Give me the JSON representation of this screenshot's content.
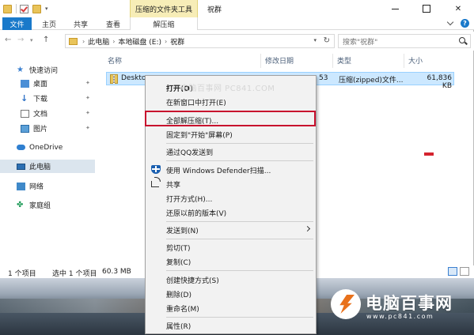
{
  "window": {
    "title": "祝群",
    "context_group": "压缩的文件夹工具"
  },
  "ribbon": {
    "tabs": [
      "文件",
      "主页",
      "共享",
      "查看",
      "解压缩"
    ]
  },
  "address": {
    "crumbs": [
      "此电脑",
      "本地磁盘 (E:)",
      "祝群"
    ],
    "search_placeholder": "搜索\"祝群\""
  },
  "nav": {
    "items": [
      {
        "label": "快速访问",
        "icon": "star-icon"
      },
      {
        "label": "桌面",
        "icon": "desktop-icon",
        "pinned": true
      },
      {
        "label": "下载",
        "icon": "download-icon",
        "pinned": true
      },
      {
        "label": "文档",
        "icon": "documents-icon",
        "pinned": true
      },
      {
        "label": "图片",
        "icon": "pictures-icon",
        "pinned": true
      },
      {
        "label": "OneDrive",
        "icon": "onedrive-icon"
      },
      {
        "label": "此电脑",
        "icon": "this-pc-icon",
        "selected": true
      },
      {
        "label": "网络",
        "icon": "network-icon"
      },
      {
        "label": "家庭组",
        "icon": "homegroup-icon"
      }
    ]
  },
  "columns": {
    "name": "名称",
    "date": "修改日期",
    "type": "类型",
    "size": "大小"
  },
  "file": {
    "name": "Desktop",
    "date_fragment": "53",
    "type": "压缩(zipped)文件...",
    "size": "61,836 KB"
  },
  "status": {
    "count": "1 个项目",
    "selected": "选中 1 个项目",
    "size": "60.3 MB"
  },
  "context_menu": {
    "watermark": "电脑百事网 PC841.COM",
    "items": [
      {
        "label": "打开(O)",
        "bold": true
      },
      {
        "label": "在新窗口中打开(E)"
      },
      {
        "sep": true
      },
      {
        "label": "全部解压缩(T)...",
        "highlighted": true
      },
      {
        "label": "固定到\"开始\"屏幕(P)"
      },
      {
        "sep": true
      },
      {
        "label": "通过QQ发送到"
      },
      {
        "sep": true
      },
      {
        "label": "使用 Windows Defender扫描...",
        "icon": "windows-defender-icon"
      },
      {
        "label": "共享",
        "icon": "share-icon"
      },
      {
        "label": "打开方式(H)..."
      },
      {
        "label": "还原以前的版本(V)"
      },
      {
        "sep": true
      },
      {
        "label": "发送到(N)",
        "submenu": true
      },
      {
        "sep": true
      },
      {
        "label": "剪切(T)"
      },
      {
        "label": "复制(C)"
      },
      {
        "sep": true
      },
      {
        "label": "创建快捷方式(S)"
      },
      {
        "label": "删除(D)"
      },
      {
        "label": "重命名(M)"
      },
      {
        "sep": true
      },
      {
        "label": "属性(R)"
      }
    ]
  },
  "watermark": {
    "brand": "电脑百事网",
    "url": "www.pc841.com"
  },
  "colors": {
    "accent": "#1979ca",
    "highlight_box": "#c8102e",
    "selection": "#cce8ff"
  }
}
